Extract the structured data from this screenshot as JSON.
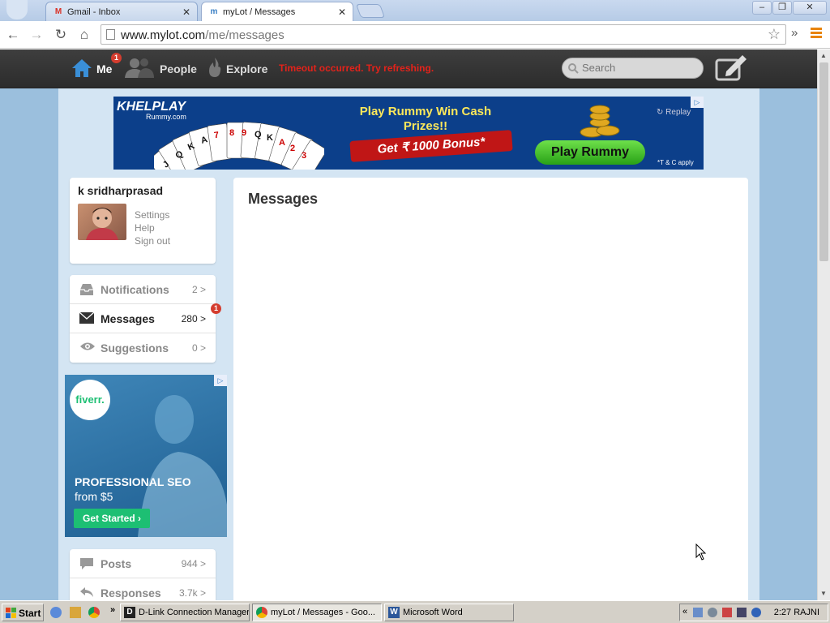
{
  "browser": {
    "tabs": [
      {
        "label": "Gmail - Inbox",
        "icon": "gmail-icon"
      },
      {
        "label": "myLot / Messages",
        "icon": "mylot-icon"
      }
    ],
    "url_domain": "www.mylot.com",
    "url_path": "/me/messages"
  },
  "header": {
    "me_label": "Me",
    "me_badge": "1",
    "people_label": "People",
    "explore_label": "Explore",
    "timeout_text": "Timeout occurred. Try refreshing.",
    "search_placeholder": "Search"
  },
  "top_ad": {
    "brand_top": "KHELPLAY",
    "brand_bottom": "Rummy.com",
    "headline_1": "Play Rummy Win Cash",
    "headline_2": "Prizes!!",
    "banner": "Get ₹ 1000 Bonus*",
    "cta": "Play Rummy",
    "replay": "Replay",
    "terms": "*T & C apply",
    "cards": [
      "J",
      "Q",
      "K",
      "A",
      "7",
      "8",
      "9",
      "Q",
      "K",
      "A",
      "2",
      "3"
    ]
  },
  "profile": {
    "name": "k sridharprasad",
    "links": [
      "Settings",
      "Help",
      "Sign out"
    ]
  },
  "sidebar_nav": [
    {
      "label": "Notifications",
      "count": "2",
      "icon": "inbox-icon"
    },
    {
      "label": "Messages",
      "count": "280",
      "icon": "envelope-icon",
      "badge": "1"
    },
    {
      "label": "Suggestions",
      "count": "0",
      "icon": "eye-icon"
    }
  ],
  "side_ad": {
    "brand": "fiverr.",
    "line1": "PROFESSIONAL SEO",
    "line2": "from $5",
    "cta": "Get Started"
  },
  "sidebar_nav2": [
    {
      "label": "Posts",
      "count": "944",
      "icon": "speech-bubble-icon"
    },
    {
      "label": "Responses",
      "count": "3.7k",
      "icon": "reply-icon"
    }
  ],
  "main": {
    "title": "Messages"
  },
  "taskbar": {
    "start": "Start",
    "buttons": [
      "D-Link Connection Manager",
      "myLot / Messages - Goo...",
      "Microsoft Word"
    ],
    "clock": "2:27 RAJNI"
  },
  "colors": {
    "accent_blue": "#3a7fc4",
    "header_dark": "#333333",
    "timeout_red": "#e3221a",
    "page_bg": "#9bbfdd"
  }
}
